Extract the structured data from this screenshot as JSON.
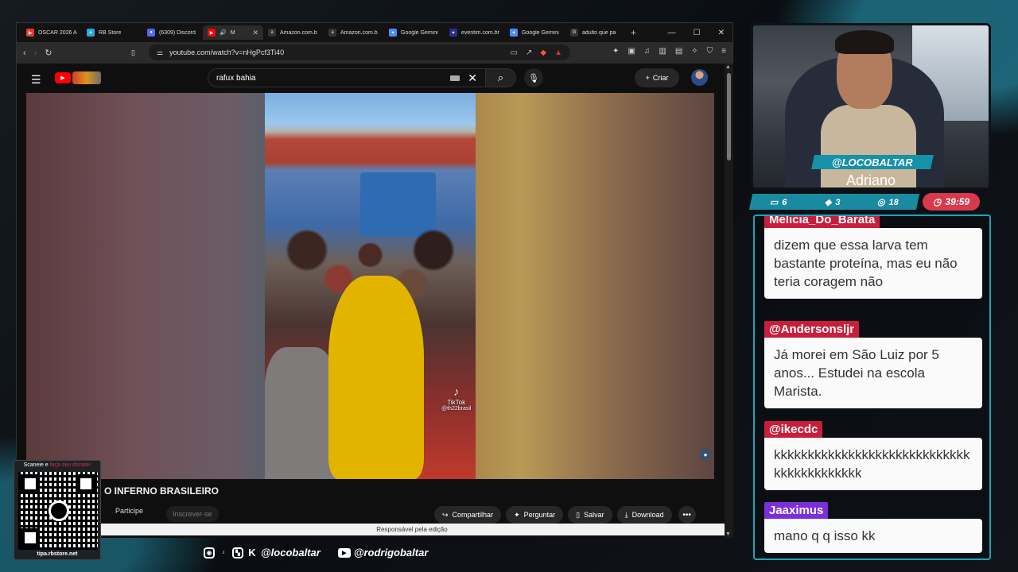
{
  "browser": {
    "tabs": [
      {
        "label": "OSCAR 2026 A",
        "color": "#e53935",
        "glyph": "▶"
      },
      {
        "label": "RB Store",
        "color": "#29a8e0",
        "glyph": "✈"
      },
      {
        "label": "(6309) Discord",
        "color": "#5865f2",
        "glyph": "●"
      },
      {
        "label": "M",
        "color": "#ff0000",
        "glyph": "▶",
        "active": true
      },
      {
        "label": "Amazon.com.b",
        "color": "#ddd",
        "glyph": "a"
      },
      {
        "label": "Amazon.com.b",
        "color": "#ddd",
        "glyph": "a"
      },
      {
        "label": "Google Gemini",
        "color": "#4e8cf7",
        "glyph": "✦"
      },
      {
        "label": "eventim.com.br",
        "color": "#2b2f8f",
        "glyph": "✦"
      },
      {
        "label": "Google Gemini",
        "color": "#4e8cf7",
        "glyph": "✦"
      },
      {
        "label": "adulto que pa",
        "color": "#fff",
        "glyph": "G"
      }
    ],
    "url": "youtube.com/watch?v=nHgPcf3Ti40"
  },
  "youtube": {
    "search_query": "rafux bahia",
    "create_label": "Criar",
    "video_title": "O INFERNO BRASILEIRO",
    "join_label": "Participe",
    "subscribe_label": "Inscrever-se",
    "actions": {
      "share": "Compartilhar",
      "ask": "Perguntar",
      "save": "Salvar",
      "download": "Download"
    },
    "edit_notice": "Responsável pela edição",
    "tiktok": {
      "logo": "TikTok",
      "handle": "@th22brasil"
    }
  },
  "overlay": {
    "handle": "@LOCOBALTAR",
    "streamer_name": "Adriano",
    "stats": {
      "chat": "6",
      "viewers": "3",
      "likes": "18"
    },
    "timer": "39:59",
    "qr_caption_prefix": "Scaneie e ",
    "qr_caption_highlight": "faça seu donate!",
    "qr_url": "tipa.rbstore.net",
    "socials": {
      "primary": "@locobaltar",
      "youtube": "@rodrigobaltar"
    }
  },
  "chat": [
    {
      "user": "Melicia_Do_Barata",
      "user_color": "#c81e3c",
      "text": "dizem que essa larva tem bastante proteína, mas eu não teria coragem não"
    },
    {
      "user": "@Andersonsljr",
      "user_color": "#c81e3c",
      "text": "Já morei em São Luiz por 5 anos... Estudei na escola Marista."
    },
    {
      "user": "@ikecdc",
      "user_color": "#c81e3c",
      "text": "kkkkkkkkkkkkkkkkkkkkkkkkkkkkkkkkkkkkkkkkkk"
    },
    {
      "user": "Jaaximus",
      "user_color": "#7b2fd8",
      "text": "mano q q isso kk"
    }
  ]
}
